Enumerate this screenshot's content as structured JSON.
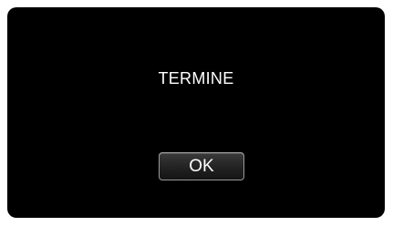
{
  "dialog": {
    "message": "TERMINE",
    "ok_label": "OK"
  },
  "colors": {
    "screen_background": "#000000",
    "text": "#ffffff",
    "button_border": "#9a9a9a"
  }
}
